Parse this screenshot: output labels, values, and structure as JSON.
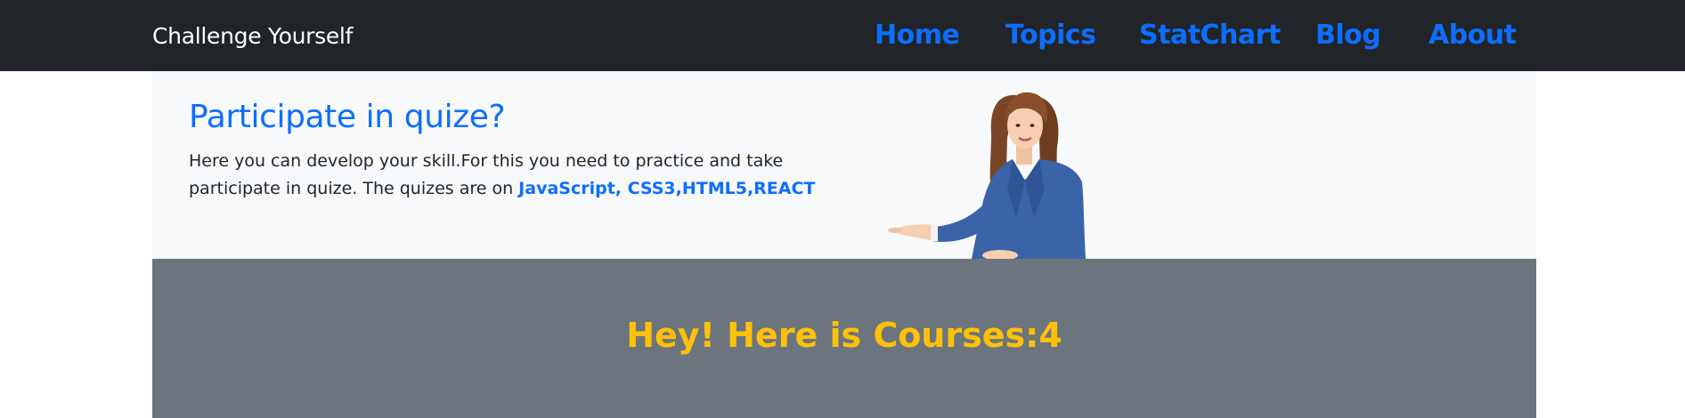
{
  "navbar": {
    "brand": "Challenge Yourself",
    "links": [
      "Home",
      "Topics",
      "StatChart",
      "Blog",
      "About"
    ]
  },
  "hero": {
    "title": "Participate in quize?",
    "text_line1": "Here you can develop your skill.For this you need to practice and take",
    "text_line2_prefix": "participate in quize. The quizes are on ",
    "technologies": "JavaScript, CSS3,HTML5,REACT"
  },
  "courses": {
    "prefix": "Hey! Here is Courses:",
    "count": "4"
  },
  "colors": {
    "navbar_bg": "#212529",
    "link": "#0d6efd",
    "hero_bg": "#f8f9fa",
    "courses_bg": "#6c757d",
    "courses_title": "#ffc107"
  },
  "icons": {
    "hero_image": "woman-presenting-illustration"
  }
}
